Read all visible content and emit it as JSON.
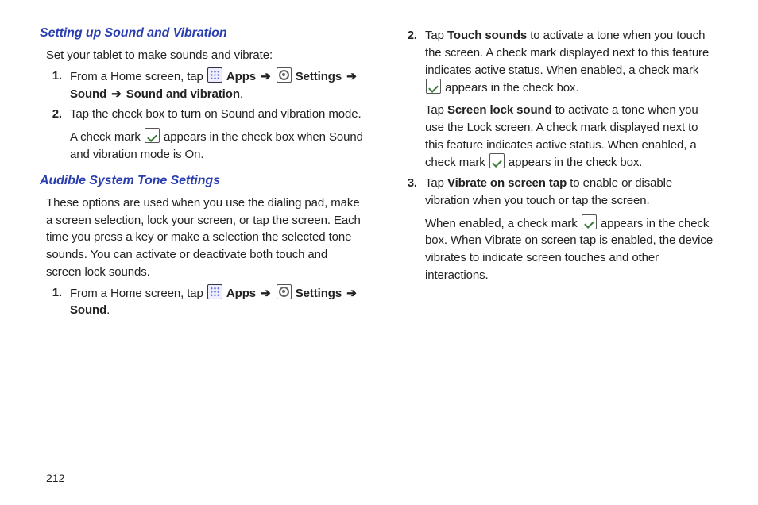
{
  "pageNumber": "212",
  "arrow": "➔",
  "labels": {
    "apps": "Apps",
    "settings": "Settings",
    "sound": "Sound",
    "soundAndVibration": "Sound and vibration",
    "touchSounds": "Touch sounds",
    "screenLockSound": "Screen lock sound",
    "vibrateOnScreenTap": "Vibrate on screen tap"
  },
  "left": {
    "h1": "Setting up Sound and Vibration",
    "intro": "Set your tablet to make sounds and vibrate:",
    "s1_lead": "From a Home screen, tap ",
    "s1_end": ".",
    "s2_a": "Tap the check box to turn on Sound and vibration mode.",
    "s2_b_pre": "A check mark ",
    "s2_b_post": " appears in the check box when Sound and vibration mode is On.",
    "h2": "Audible System Tone Settings",
    "desc": "These options are used when you use the dialing pad, make a screen selection, lock your screen, or tap the screen. Each time you press a key or make a selection the selected tone sounds. You can activate or deactivate both touch and screen lock sounds.",
    "b1_lead": "From a Home screen, tap ",
    "b1_end": "."
  },
  "right": {
    "s2_a_pre": "Tap ",
    "s2_a_post": " to activate a tone when you touch the screen. A check mark displayed next to this feature indicates active status. When enabled, a check mark ",
    "s2_a_tail": " appears in the check box.",
    "s2_b_pre": "Tap ",
    "s2_b_post": " to activate a tone when you use the Lock screen. A check mark displayed next to this feature indicates active status. When enabled, a check mark ",
    "s2_b_tail": " appears in the check box.",
    "s3_a_pre": "Tap ",
    "s3_a_post": " to enable or disable vibration when you touch or tap the screen.",
    "s3_b_pre": "When enabled, a check mark ",
    "s3_b_post": " appears in the check box. When Vibrate on screen tap is enabled, the device vibrates to indicate screen touches and other interactions."
  }
}
